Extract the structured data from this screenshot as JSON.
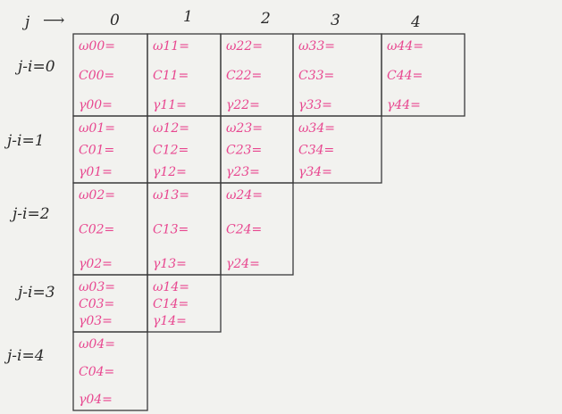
{
  "header": {
    "j_label": "j",
    "arrow": "⟶"
  },
  "columns": [
    "0",
    "1",
    "2",
    "3",
    "4"
  ],
  "rows": [
    "j-i=0",
    "j-i=1",
    "j-i=2",
    "j-i=3",
    "j-i=4"
  ],
  "cells": [
    [
      {
        "w": "ω00=",
        "c": "C00=",
        "r": "γ00="
      },
      {
        "w": "ω11=",
        "c": "C11=",
        "r": "γ11="
      },
      {
        "w": "ω22=",
        "c": "C22=",
        "r": "γ22="
      },
      {
        "w": "ω33=",
        "c": "C33=",
        "r": "γ33="
      },
      {
        "w": "ω44=",
        "c": "C44=",
        "r": "γ44="
      }
    ],
    [
      {
        "w": "ω01=",
        "c": "C01=",
        "r": "γ01="
      },
      {
        "w": "ω12=",
        "c": "C12=",
        "r": "γ12="
      },
      {
        "w": "ω23=",
        "c": "C23=",
        "r": "γ23="
      },
      {
        "w": "ω34=",
        "c": "C34=",
        "r": "γ34="
      }
    ],
    [
      {
        "w": "ω02=",
        "c": "C02=",
        "r": "γ02="
      },
      {
        "w": "ω13=",
        "c": "C13=",
        "r": "γ13="
      },
      {
        "w": "ω24=",
        "c": "C24=",
        "r": "γ24="
      }
    ],
    [
      {
        "w": "ω03=",
        "c": "C03=",
        "r": "γ03="
      },
      {
        "w": "ω14=",
        "c": "C14=",
        "r": "γ14="
      }
    ],
    [
      {
        "w": "ω04=",
        "c": "C04=",
        "r": "γ04="
      }
    ]
  ],
  "colors": {
    "ink": "#2a2a2a",
    "pink": "#e8468f",
    "paper": "#f2f2ef"
  }
}
